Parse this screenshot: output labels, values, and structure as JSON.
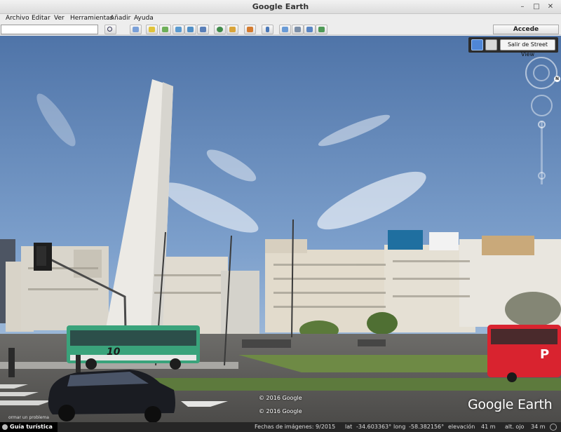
{
  "window": {
    "title": "Google Earth",
    "minimize": "–",
    "maximize": "□",
    "close": "✕"
  },
  "menu": [
    "Archivo",
    "Editar",
    "Ver",
    "Herramientas",
    "Añadir",
    "Ayuda"
  ],
  "toolbar": {
    "search_value": "",
    "signin_label": "Accede",
    "icons": [
      "search-icon",
      "sidebar-icon",
      "placemark-icon",
      "polygon-icon",
      "path-icon",
      "image-overlay-icon",
      "tour-record-icon",
      "historical-imagery-icon",
      "sunlight-icon",
      "planets-icon",
      "ruler-icon",
      "email-icon",
      "print-icon",
      "save-image-icon",
      "maps-icon"
    ]
  },
  "street_view": {
    "exit_label": "Salir de Street View",
    "person_icon": "pegman-icon",
    "cube_icon": "3d-cube-icon"
  },
  "nav": {
    "north_label": "N"
  },
  "viewport": {
    "copyright_1": "© 2016 Google",
    "copyright_2": "© 2016 Google",
    "report_label": "ormar un problema",
    "logo": "Google Earth",
    "bus_number": "10"
  },
  "status": {
    "tour_label": "Guía turística",
    "imagery_date": "Fechas de imágenes: 9/2015",
    "lat_label": "lat",
    "lat_value": "-34.603363°",
    "long_label": "long",
    "long_value": "-58.382156°",
    "elev_label": "elevación",
    "elev_value": "41 m",
    "eye_label": "alt. ojo",
    "eye_value": "34 m"
  },
  "colors": {
    "sky": "#5a7fb5",
    "status_bg": "#262626",
    "bus_green": "#3aa37b",
    "bus_red": "#d9232f"
  }
}
